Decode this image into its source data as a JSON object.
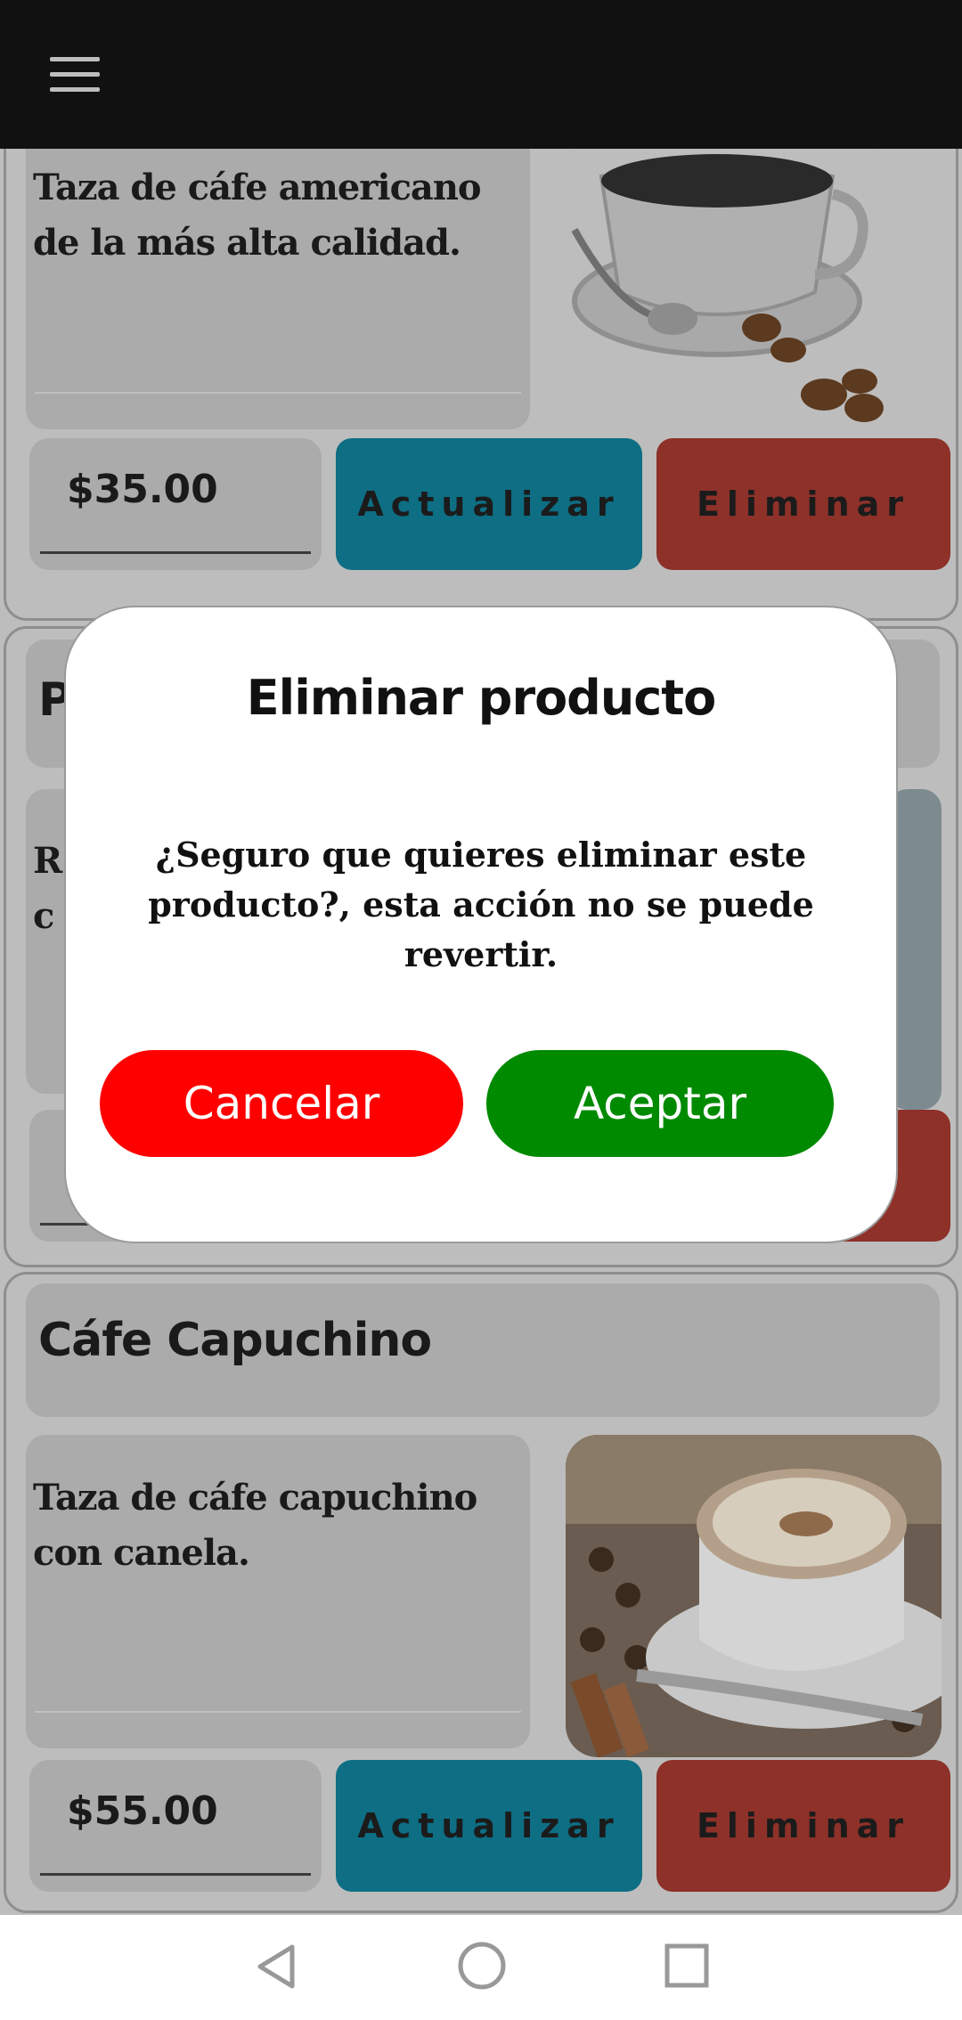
{
  "top_bar": {
    "menu_icon": "hamburger-menu-icon"
  },
  "products": [
    {
      "title": "",
      "description": "Taza de cáfe americano de la más alta calidad.",
      "price": "$35.00",
      "update_label": "Actualizar",
      "delete_label": "Eliminar"
    },
    {
      "title_partial": "P",
      "description_partial_line1": "R",
      "description_partial_line2": "c"
    },
    {
      "title": "Cáfe Capuchino",
      "description": "Taza de cáfe capuchino con canela.",
      "price": "$55.00",
      "update_label": "Actualizar",
      "delete_label": "Eliminar"
    }
  ],
  "dialog": {
    "title": "Eliminar producto",
    "message": "¿Seguro que quieres eliminar este producto?, esta acción no se puede revertir.",
    "cancel_label": "Cancelar",
    "accept_label": "Aceptar",
    "colors": {
      "cancel": "#ff0000",
      "accept": "#008a00"
    }
  },
  "nav_bar": {
    "back_icon": "back-triangle-icon",
    "home_icon": "home-circle-icon",
    "recents_icon": "recents-square-icon"
  }
}
